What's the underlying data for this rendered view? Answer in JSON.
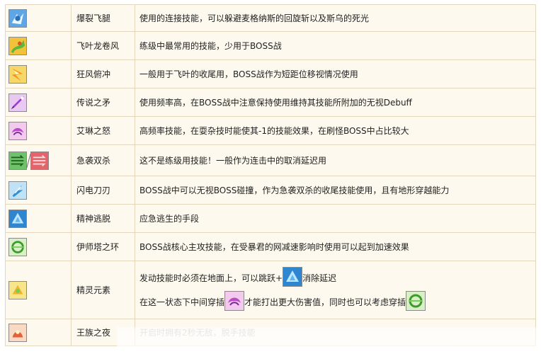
{
  "skills": [
    {
      "name": "爆裂飞腿",
      "desc": "使用的连接技能，可以躲避麦格纳斯的回旋斩以及斯乌的死光"
    },
    {
      "name": "飞叶龙卷风",
      "desc": "练级中最常用的技能，少用于BOSS战"
    },
    {
      "name": "狂风俯冲",
      "desc": "一般用于飞叶的收尾用，BOSS战作为短距位移视情况使用"
    },
    {
      "name": "传说之矛",
      "desc": "使用频率高，在BOSS战中注意保持使用维持其技能所附加的无视Debuff"
    },
    {
      "name": "艾琳之怒",
      "desc": "高频率技能，在耍杂技时能使其-1的技能效果，在刷怪BOSS中占比较大"
    },
    {
      "name": "急袭双杀",
      "desc": "这不是练级用技能！一般作为连击中的取消延迟用"
    },
    {
      "name": "闪电刀刃",
      "desc": "BOSS战中可以无视BOSS碰撞，作为急袭双杀的收尾技能使用，且有地形穿越能力"
    },
    {
      "name": "精神逃脱",
      "desc": "应急逃生的手段"
    },
    {
      "name": "伊师塔之环",
      "desc": "BOSS战核心主攻技能，在受暴君的网减速影响时使用可以起到加速效果"
    },
    {
      "name": "精灵元素",
      "line1_a": "发动技能时必须在地面上，可以跳跃+",
      "line1_b": "消除延迟",
      "line2_a": "在这一状态下中间穿插",
      "line2_b": "才能打出更大伤害值，同时也可以考虑穿插"
    },
    {
      "name": "王族之夜",
      "desc": "开启时拥有2秒无敌，脱手技能"
    }
  ],
  "icons": [
    "kick-icon",
    "leaf-tornado-icon",
    "gale-dive-icon",
    "legend-spear-icon",
    "irina-wrath-icon",
    "double-strike-icon",
    "lightning-blade-icon",
    "spirit-escape-icon",
    "ishtar-ring-icon",
    "spirit-element-icon",
    "royal-night-icon"
  ]
}
